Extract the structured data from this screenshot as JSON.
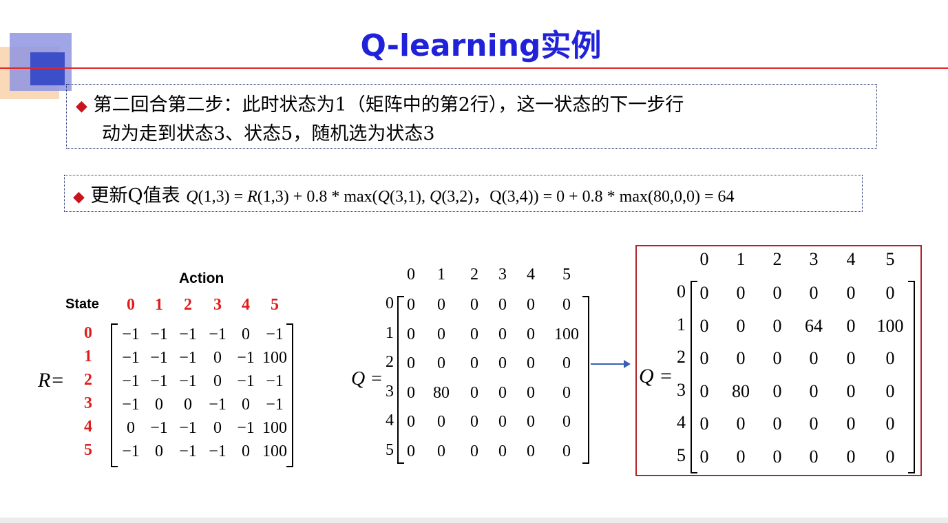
{
  "title": "Q-learning实例",
  "bullet1": {
    "line1": "第二回合第二步：此时状态为1（矩阵中的第2行），这一状态的下一步行",
    "line2": "动为走到状态3、状态5，随机选为状态3"
  },
  "bullet2": {
    "label": "更新Q值表",
    "formula_parts": [
      "Q",
      "(1,3) = ",
      "R",
      "(1,3) + 0.8 * max(",
      "Q",
      "(3,1), ",
      "Q",
      "(3,2)，Q(3,4)) = 0 + 0.8 * max(80,0,0) = 64"
    ]
  },
  "r_matrix": {
    "action_label": "Action",
    "state_label": "State",
    "eq_label": "R=",
    "col_headers": [
      "0",
      "1",
      "2",
      "3",
      "4",
      "5"
    ],
    "row_headers": [
      "0",
      "1",
      "2",
      "3",
      "4",
      "5"
    ],
    "rows": [
      [
        "−1",
        "−1",
        "−1",
        "−1",
        "0",
        "−1"
      ],
      [
        "−1",
        "−1",
        "−1",
        "0",
        "−1",
        "100"
      ],
      [
        "−1",
        "−1",
        "−1",
        "0",
        "−1",
        "−1"
      ],
      [
        "−1",
        "0",
        "0",
        "−1",
        "0",
        "−1"
      ],
      [
        "0",
        "−1",
        "−1",
        "0",
        "−1",
        "100"
      ],
      [
        "−1",
        "0",
        "−1",
        "−1",
        "0",
        "100"
      ]
    ]
  },
  "q_before": {
    "eq_label": "Q =",
    "col_headers": [
      "0",
      "1",
      "2",
      "3",
      "4",
      "5"
    ],
    "row_headers": [
      "0",
      "1",
      "2",
      "3",
      "4",
      "5"
    ],
    "rows": [
      [
        "0",
        "0",
        "0",
        "0",
        "0",
        "0"
      ],
      [
        "0",
        "0",
        "0",
        "0",
        "0",
        "100"
      ],
      [
        "0",
        "0",
        "0",
        "0",
        "0",
        "0"
      ],
      [
        "0",
        "80",
        "0",
        "0",
        "0",
        "0"
      ],
      [
        "0",
        "0",
        "0",
        "0",
        "0",
        "0"
      ],
      [
        "0",
        "0",
        "0",
        "0",
        "0",
        "0"
      ]
    ]
  },
  "q_after": {
    "eq_label": "Q =",
    "col_headers": [
      "0",
      "1",
      "2",
      "3",
      "4",
      "5"
    ],
    "row_headers": [
      "0",
      "1",
      "2",
      "3",
      "4",
      "5"
    ],
    "rows": [
      [
        "0",
        "0",
        "0",
        "0",
        "0",
        "0"
      ],
      [
        "0",
        "0",
        "0",
        "64",
        "0",
        "100"
      ],
      [
        "0",
        "0",
        "0",
        "0",
        "0",
        "0"
      ],
      [
        "0",
        "80",
        "0",
        "0",
        "0",
        "0"
      ],
      [
        "0",
        "0",
        "0",
        "0",
        "0",
        "0"
      ],
      [
        "0",
        "0",
        "0",
        "0",
        "0",
        "0"
      ]
    ]
  },
  "colors": {
    "title": "#1f22d8",
    "accent_red": "#e0262b",
    "highlight_red": "#e01b1b",
    "box_border": "#1a2a6c",
    "arrow": "#3a5fb0"
  },
  "icons": {
    "bullet": "diamond-bullet-icon",
    "arrow": "right-arrow-icon"
  }
}
